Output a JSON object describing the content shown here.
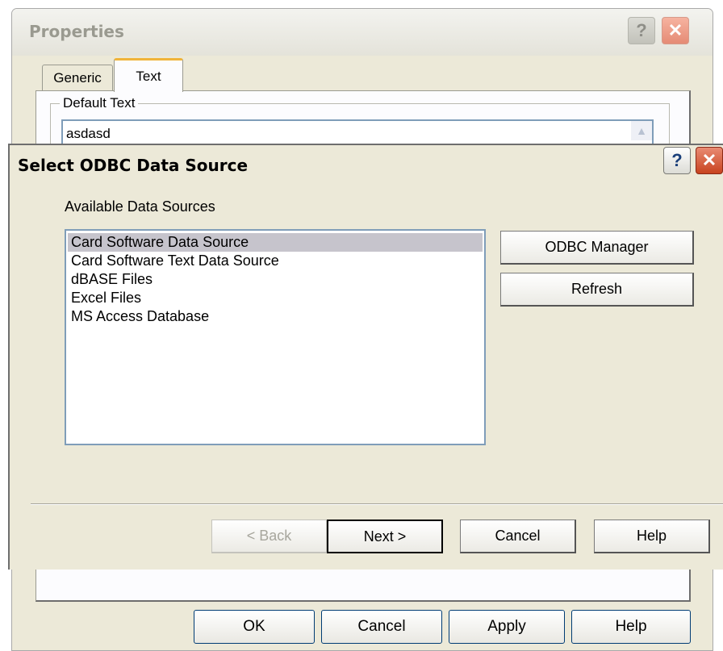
{
  "properties_dialog": {
    "title": "Properties",
    "help_glyph": "?",
    "close_glyph": "✕",
    "tabs": [
      {
        "label": "Generic"
      },
      {
        "label": "Text"
      }
    ],
    "group_label": "Default Text",
    "default_text_value": "asdasd",
    "buttons": {
      "ok": "OK",
      "cancel": "Cancel",
      "apply": "Apply",
      "help": "Help"
    }
  },
  "odbc_dialog": {
    "title": "Select ODBC Data Source",
    "help_glyph": "?",
    "close_glyph": "✕",
    "available_label": "Available Data Sources",
    "data_sources": [
      {
        "label": "Card Software Data Source",
        "selected": true
      },
      {
        "label": "Card Software Text Data Source",
        "selected": false
      },
      {
        "label": "dBASE Files",
        "selected": false
      },
      {
        "label": "Excel Files",
        "selected": false
      },
      {
        "label": "MS Access Database",
        "selected": false
      }
    ],
    "side_buttons": {
      "odbc_manager": "ODBC Manager",
      "refresh": "Refresh"
    },
    "wizard_buttons": {
      "back": "< Back",
      "next": "Next >",
      "cancel": "Cancel",
      "help": "Help"
    }
  }
}
